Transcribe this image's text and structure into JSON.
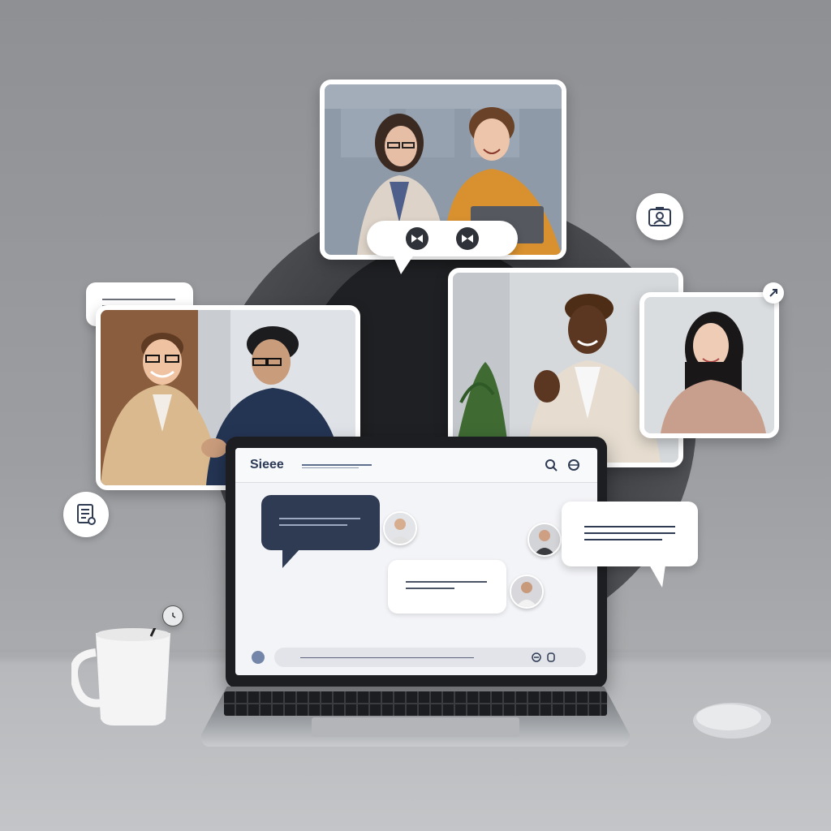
{
  "app": {
    "title": "Sieee",
    "composer_placeholder": ""
  },
  "icons": {
    "header_search": "search-icon",
    "header_globe": "globe-icon",
    "composer_emoji": "emoji-icon",
    "composer_attach": "attach-icon",
    "controls_left": "bowtie-icon",
    "controls_right": "bowtie-icon",
    "chip_camera": "camera-person-icon",
    "chip_notes": "notes-icon",
    "chip_small": "send-icon",
    "chip_clock": "clock-icon"
  },
  "colors": {
    "accent_dark": "#2e3b52",
    "title": "#2c3a57",
    "background": "#9c9ea2"
  }
}
